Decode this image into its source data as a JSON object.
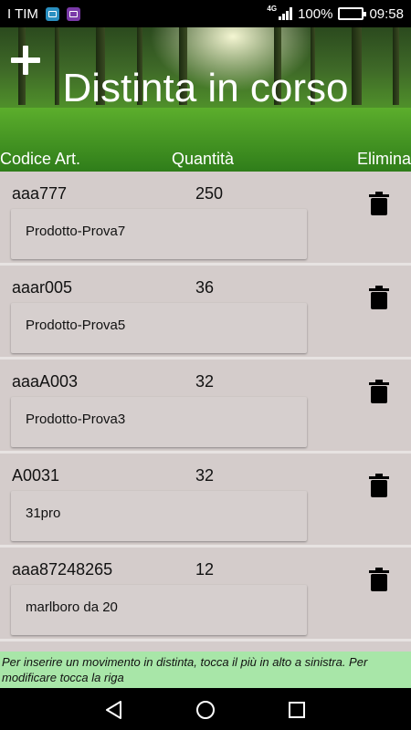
{
  "status_bar": {
    "carrier": "I TIM",
    "network": "4G",
    "battery": "100%",
    "time": "09:58"
  },
  "header": {
    "title": "Distinta in corso",
    "columns": {
      "code": "Codice Art.",
      "quantity": "Quantità",
      "delete": "Elimina"
    }
  },
  "rows": [
    {
      "code": "aaa777",
      "quantity": "250",
      "description": "Prodotto-Prova7"
    },
    {
      "code": "aaar005",
      "quantity": "36",
      "description": "Prodotto-Prova5"
    },
    {
      "code": "aaaA003",
      "quantity": "32",
      "description": "Prodotto-Prova3"
    },
    {
      "code": "A0031",
      "quantity": "32",
      "description": "31pro"
    },
    {
      "code": "aaa87248265",
      "quantity": "12",
      "description": "marlboro da 20"
    }
  ],
  "info_text": "Per inserire un movimento in distinta, tocca il più in alto a sinistra. Per modificare tocca la riga",
  "colors": {
    "list_background": "#d4cccb",
    "info_background": "#a8e6a8",
    "battery": "#7cc13e"
  },
  "icons": [
    "plus-icon",
    "trash-icon",
    "back-icon",
    "home-icon",
    "recent-apps-icon"
  ]
}
